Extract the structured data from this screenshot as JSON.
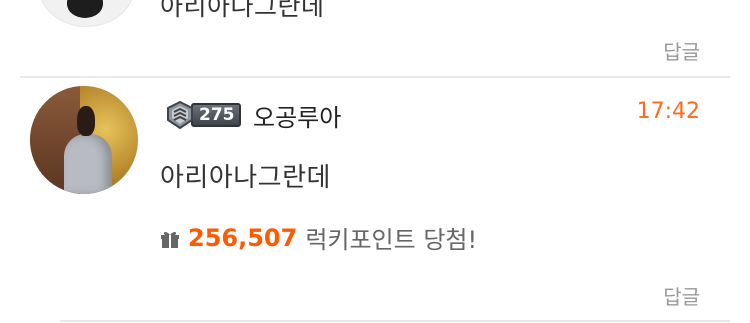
{
  "previous_comment": {
    "text": "아리아나그란데",
    "reply_label": "답글"
  },
  "comment": {
    "user": {
      "level": "275",
      "name": "오공루아",
      "avatar_icon": "user-avatar-photo",
      "rank_icon": "shield-icon"
    },
    "time": "17:42",
    "text": "아리아나그란데",
    "lucky": {
      "icon": "gift-icon",
      "points": "256,507",
      "label": "럭키포인트 당첨!"
    },
    "reply_label": "답글"
  },
  "colors": {
    "accent": "#ff6a1f",
    "points": "#ff5a00",
    "muted": "#999999",
    "divider": "#e8e8e8"
  }
}
